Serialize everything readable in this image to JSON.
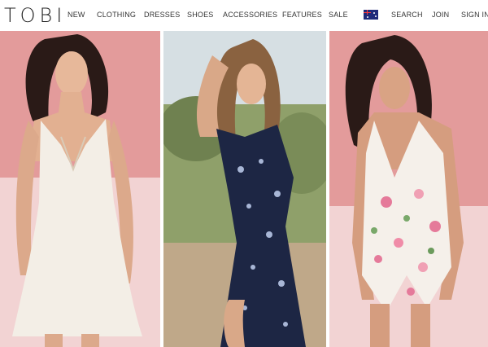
{
  "brand": {
    "logo_text": "TOBI"
  },
  "nav": {
    "items": [
      {
        "label": "NEW"
      },
      {
        "label": "CLOTHING"
      },
      {
        "label": "DRESSES"
      },
      {
        "label": "SHOES"
      },
      {
        "label": "ACCESSORIES"
      },
      {
        "label": "FEATURES"
      },
      {
        "label": "SALE"
      }
    ],
    "search": "SEARCH",
    "join": "JOIN",
    "sign_in": "SIGN IN"
  },
  "region": {
    "flag_icon": "australia-flag-icon"
  },
  "colors": {
    "pink_wall": "#e59a9a",
    "light_pink": "#f3d6d6",
    "navy_dress": "#1d2644",
    "cream_dress": "#f3eee6",
    "sky": "#cfd9de"
  }
}
